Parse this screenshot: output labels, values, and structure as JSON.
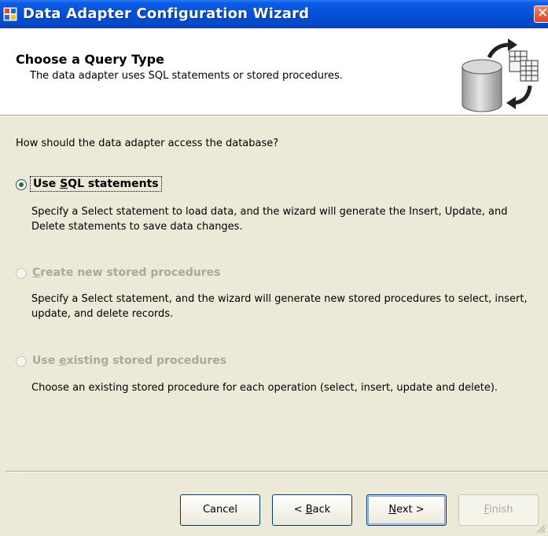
{
  "window": {
    "title": "Data Adapter Configuration Wizard",
    "close_glyph": "✕"
  },
  "header": {
    "title": "Choose a Query Type",
    "subtitle": "The data adapter uses SQL statements or stored procedures.",
    "art_icon": "database-table-exchange-icon"
  },
  "main": {
    "prompt": "How should the data adapter access the database?",
    "options": [
      {
        "label_pre": "Use ",
        "label_key": "S",
        "label_post": "QL statements",
        "description": "Specify a Select statement to load data, and the wizard will generate the Insert, Update, and Delete statements to save data changes.",
        "selected": true,
        "enabled": true
      },
      {
        "label_pre": "",
        "label_key": "C",
        "label_post": "reate new stored procedures",
        "description": "Specify a Select statement, and the wizard will generate new stored procedures to select, insert, update, and delete records.",
        "selected": false,
        "enabled": false
      },
      {
        "label_pre": "Use ",
        "label_key": "e",
        "label_post": "xisting stored procedures",
        "description": "Choose an existing stored procedure for each operation (select, insert, update and delete).",
        "selected": false,
        "enabled": false
      }
    ]
  },
  "footer": {
    "cancel": "Cancel",
    "back_pre": "< ",
    "back_key": "B",
    "back_post": "ack",
    "next_key": "N",
    "next_post": "ext >",
    "finish_key": "F",
    "finish_post": "inish"
  },
  "colors": {
    "titlebar": "#0550d6",
    "dialog_bg": "#ece9d8",
    "radio_dot": "#1f7b16",
    "disabled_text": "#aca899"
  }
}
